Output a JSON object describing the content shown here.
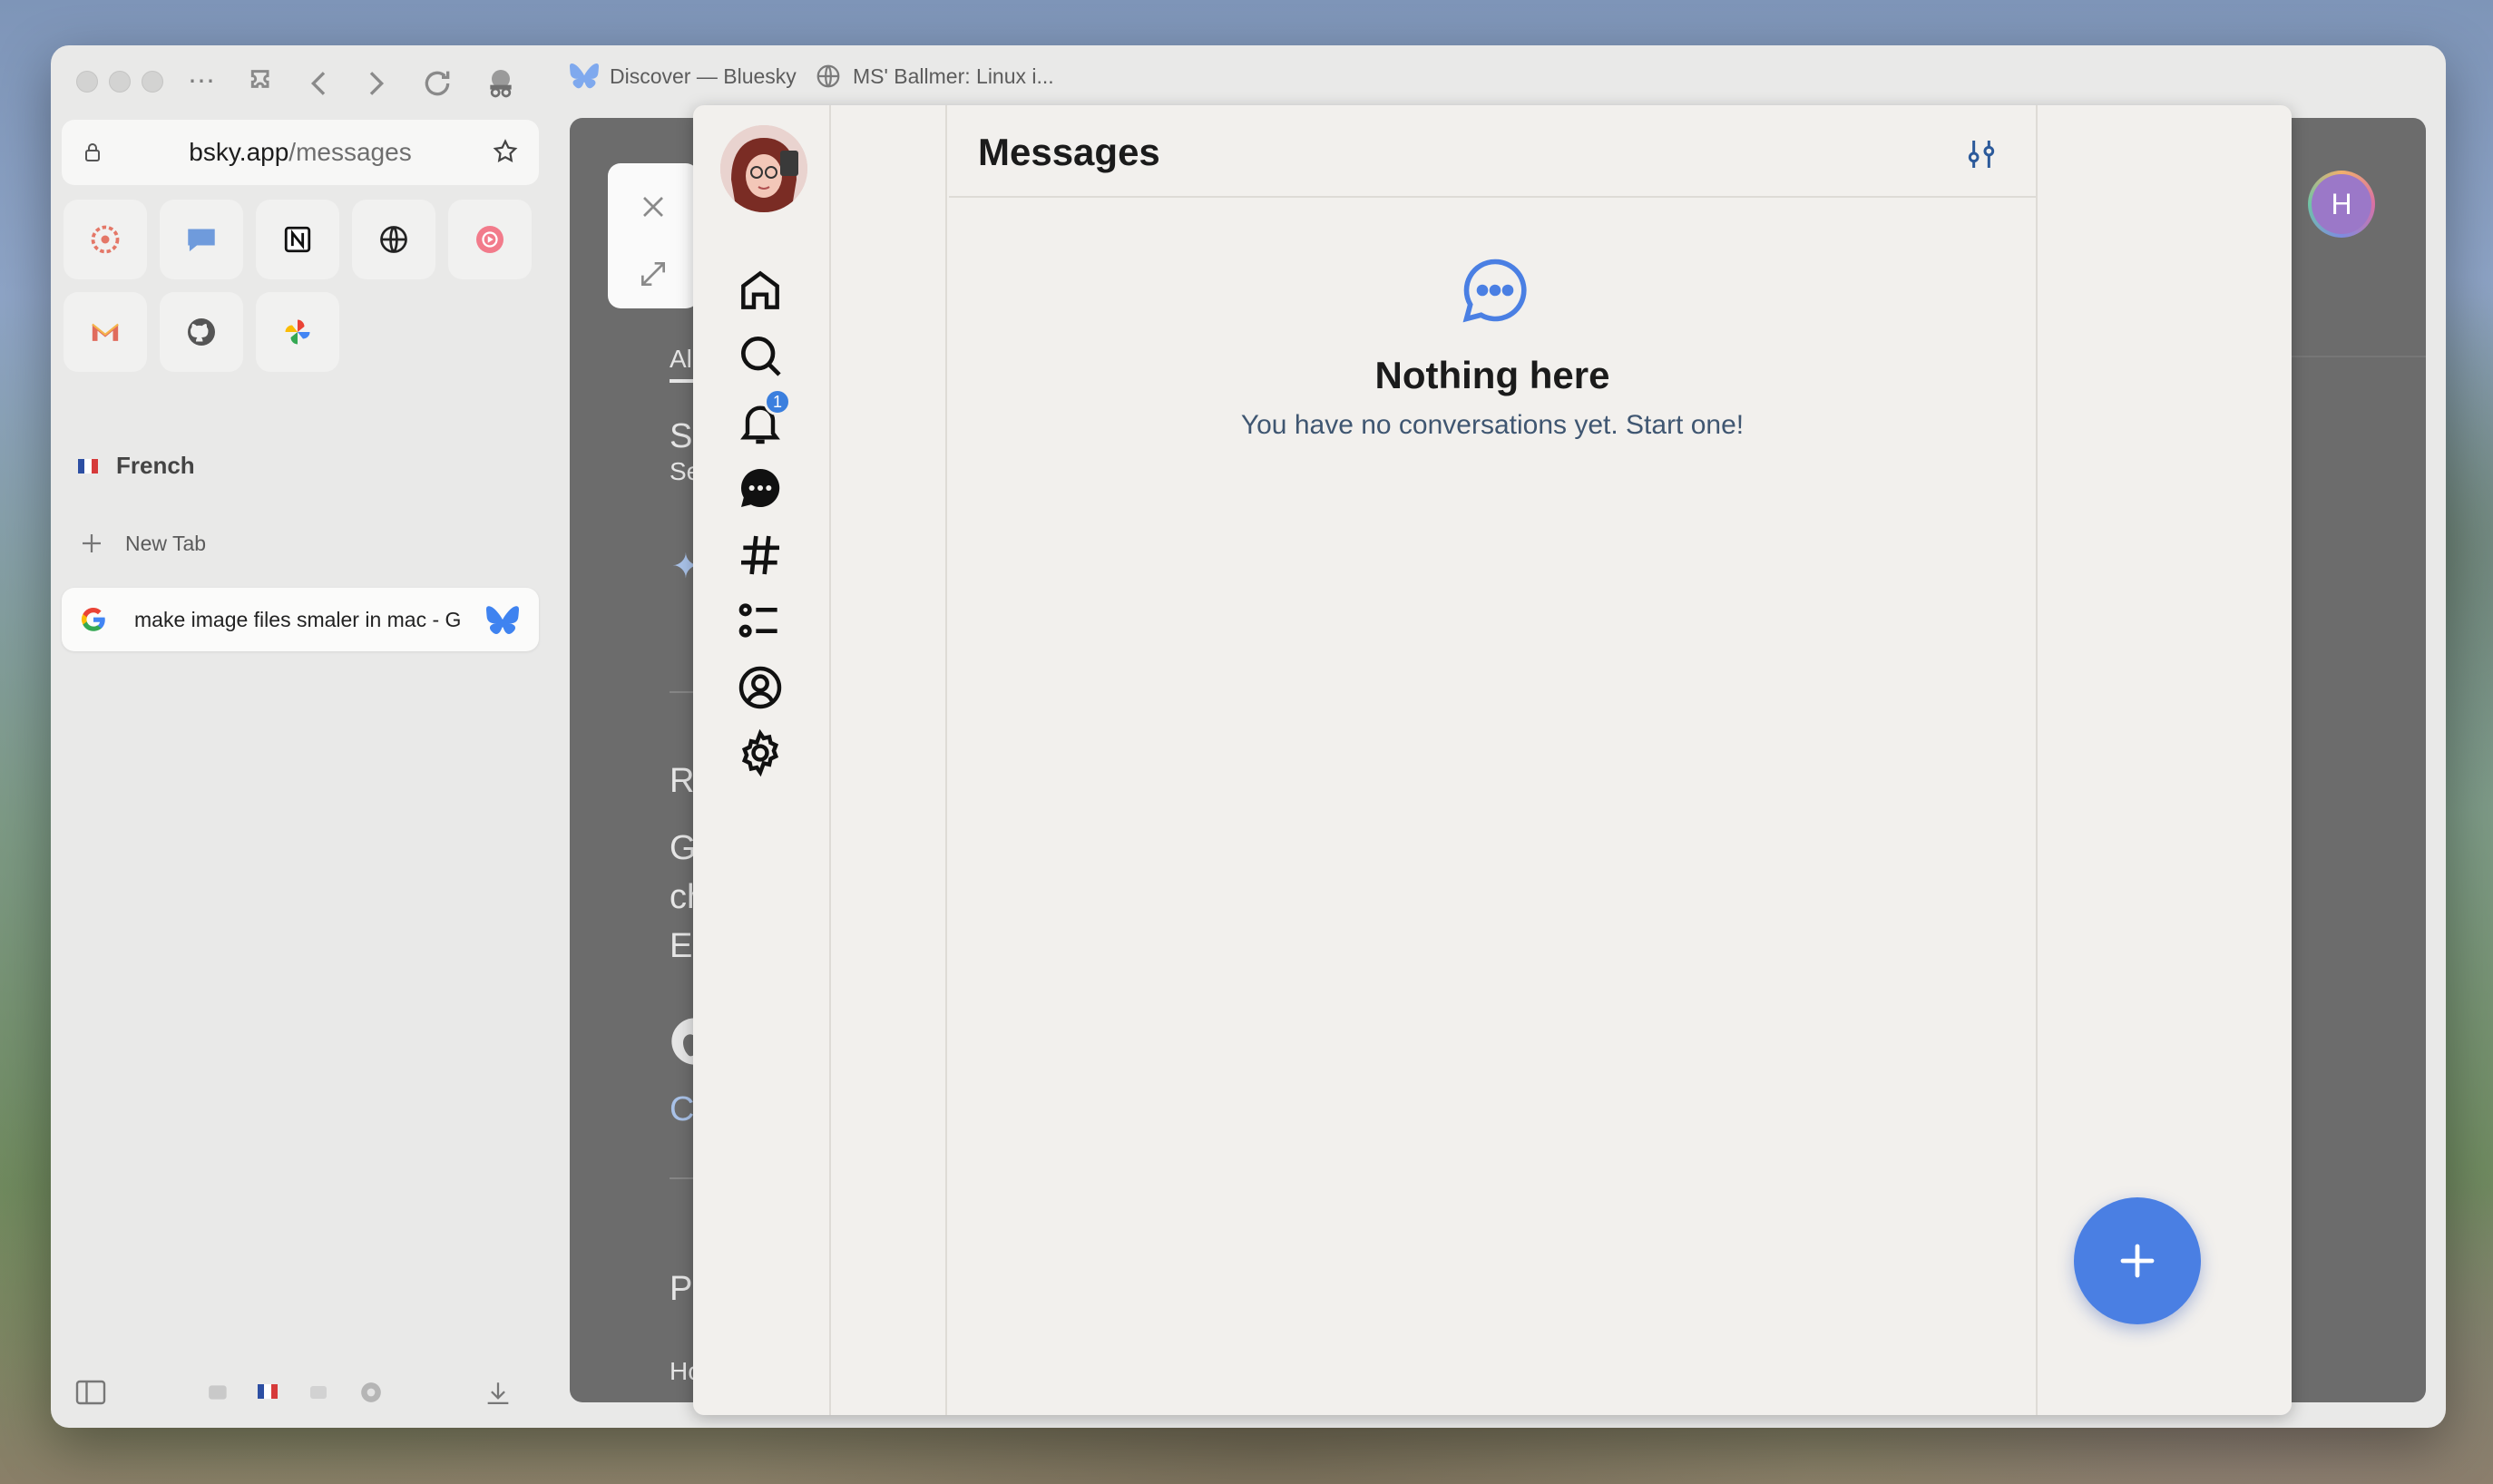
{
  "browser": {
    "url_host": "bsky.app",
    "url_path": "/messages",
    "top_tabs": [
      {
        "label": "Discover — Bluesky",
        "icon": "butterfly-icon"
      },
      {
        "label": "MS' Ballmer: Linux i...",
        "icon": "globe-icon"
      }
    ],
    "space_name": "French",
    "new_tab_label": "New Tab",
    "active_tab_title": "make image files smaler in mac - G"
  },
  "background_page": {
    "tab_all": "All",
    "show": "Show",
    "search": "Searc",
    "reduce": "Redu",
    "go_to": "Go t",
    "chan": "chan",
    "enter": "Ente",
    "crop": "Crop",
    "people": "Peop",
    "how": "How c",
    "avatar_letter": "H"
  },
  "bluesky": {
    "messages_title": "Messages",
    "empty_title": "Nothing here",
    "empty_subtitle": "You have no conversations yet. Start one!",
    "notification_count": "1",
    "accent_color": "#4a7fe3"
  }
}
